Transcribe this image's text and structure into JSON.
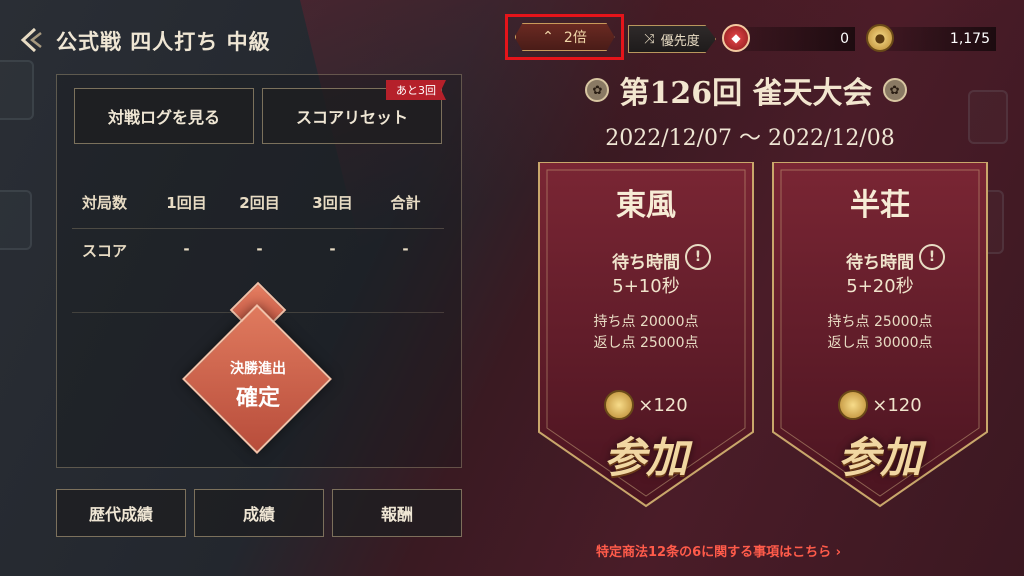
{
  "header": {
    "title": "公式戦 四人打ち 中級"
  },
  "left": {
    "log_button": "対戦ログを見る",
    "reset_button": "スコアリセット",
    "reset_badge": "あと3回",
    "table": {
      "headers": [
        "対局数",
        "1回目",
        "2回目",
        "3回目",
        "合計"
      ],
      "row_label": "スコア",
      "row_values": [
        "-",
        "-",
        "-",
        "-"
      ]
    },
    "status_small": "決勝進出",
    "status_big": "確定",
    "bottom_buttons": [
      "歴代成績",
      "成績",
      "報酬"
    ]
  },
  "topbar": {
    "multiplier": "2倍",
    "priority": "優先度",
    "gems": "0",
    "coins": "1,175"
  },
  "tournament": {
    "name": "第126回 雀天大会",
    "dates": "2022/12/07 ～ 2022/12/08",
    "modes": [
      {
        "title": "東風",
        "wait_label": "待ち時間",
        "time": "5+10秒",
        "start_pts": "持ち点 20000点",
        "return_pts": "返し点 25000点",
        "cost": "×120",
        "join": "参加"
      },
      {
        "title": "半荘",
        "wait_label": "待ち時間",
        "time": "5+20秒",
        "start_pts": "持ち点 25000点",
        "return_pts": "返し点 30000点",
        "cost": "×120",
        "join": "参加"
      }
    ],
    "legal_link": "特定商法12条の6に関する事項はこちら"
  },
  "colors": {
    "highlight": "#e5141a",
    "accent_red": "#b5202a",
    "link_red": "#ff5b4a"
  }
}
